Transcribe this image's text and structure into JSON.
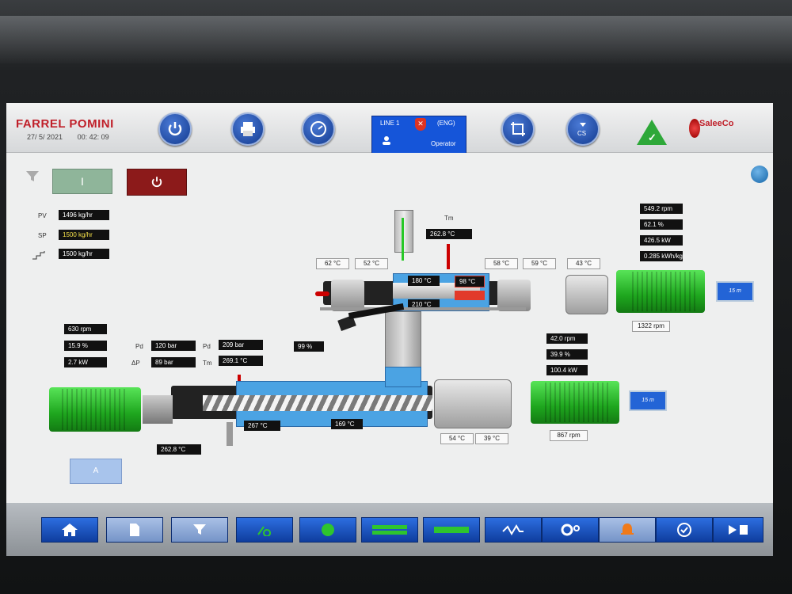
{
  "header": {
    "brand": "FARREL POMINI",
    "date": "27/ 5/ 2021",
    "time": "00: 42: 09",
    "line_label": "LINE 1",
    "language": "(ENG)",
    "user_role": "Operator",
    "vendor": "SaleeCo"
  },
  "controls": {
    "start_label": "I"
  },
  "feed": {
    "pv_label": "PV",
    "pv_value": "1496 kg/hr",
    "sp_label": "SP",
    "sp_value": "1500 kg/hr",
    "ramp_value": "1500 kg/hr"
  },
  "upper_extruder": {
    "tm_label": "Tm",
    "tm_value": "262.8 °C",
    "zone_temps": [
      "62 °C",
      "52 °C",
      "58 °C",
      "59 °C",
      "43 °C"
    ],
    "barrel_temps": [
      "180 °C",
      "98 °C",
      "210 °C"
    ],
    "motor_values": [
      "549.2 rpm",
      "62.1 %",
      "426.5 kW",
      "0.285 kWh/kg"
    ],
    "motor_rpm": "1322 rpm",
    "monitor_label": "15 m"
  },
  "lower_extruder": {
    "rpm": "630 rpm",
    "percent": "15.9 %",
    "kw": "2.7 kW",
    "pd_label": "Pd",
    "pd_value": "120 bar",
    "dp_label": "ΔP",
    "dp_value": "89 bar",
    "pd2_label": "Pd",
    "pd2_value": "209 bar",
    "tm_label": "Tm",
    "tm_value": "269.1 °C",
    "valve_percent": "99 %",
    "barrel_temps": [
      "267 °C",
      "169 °C"
    ],
    "gear_temps": [
      "54 °C",
      "39 °C"
    ],
    "melt_temp": "262.8 °C",
    "motor_values": [
      "42.0 rpm",
      "39.9 %",
      "100.4 kW"
    ],
    "motor_rpm": "867 rpm",
    "monitor_label": "15 m",
    "auto_label": "A"
  },
  "colors": {
    "accent_blue": "#1555d9",
    "motor_green": "#2ec52e",
    "alarm_red": "#c0202a",
    "barrel_blue": "#4ba3e3"
  }
}
